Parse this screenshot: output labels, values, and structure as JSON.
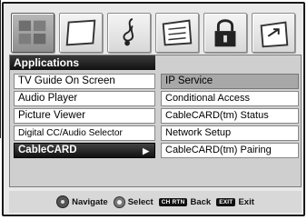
{
  "menu": {
    "title": "Applications",
    "icons": [
      {
        "name": "setup-tile-icon",
        "active": true
      },
      {
        "name": "picture-tile-icon",
        "active": false
      },
      {
        "name": "audio-tile-icon",
        "active": false
      },
      {
        "name": "preferences-tile-icon",
        "active": false
      },
      {
        "name": "lock-tile-icon",
        "active": false
      },
      {
        "name": "applications-tile-icon",
        "active": false
      }
    ],
    "left_items": [
      {
        "label": "TV Guide On Screen"
      },
      {
        "label": "Audio Player"
      },
      {
        "label": "Picture Viewer"
      },
      {
        "label": "Digital CC/Audio Selector"
      },
      {
        "label": "CableCARD",
        "selected": true,
        "arrow": "▶"
      }
    ],
    "right_items": [
      {
        "label": "IP Service",
        "highlighted": true
      },
      {
        "label": "Conditional Access"
      },
      {
        "label": "CableCARD(tm) Status"
      },
      {
        "label": "Network Setup"
      },
      {
        "label": "CableCARD(tm) Pairing"
      }
    ]
  },
  "legend": {
    "navigate": "Navigate",
    "select": "Select",
    "back_key": "CH RTN",
    "back": "Back",
    "exit_key": "EXIT",
    "exit": "Exit"
  }
}
